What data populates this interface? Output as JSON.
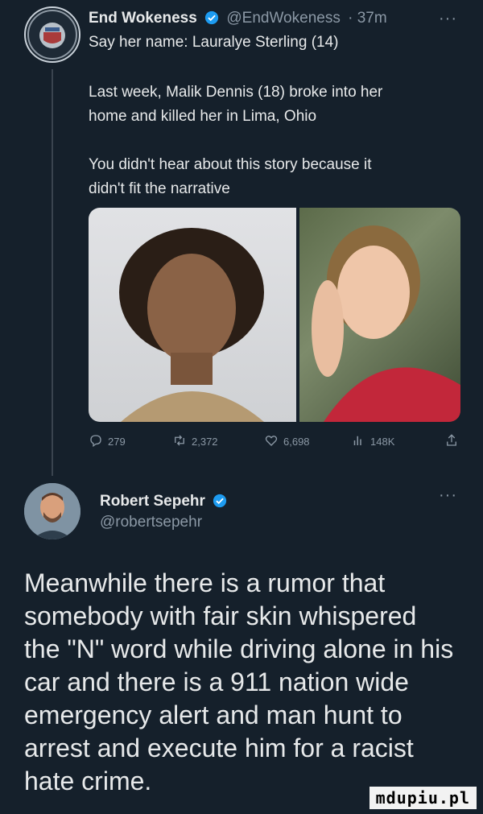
{
  "tweet1": {
    "display_name": "End Wokeness",
    "handle": "@EndWokeness",
    "time": "· 37m",
    "more": "···",
    "lines": [
      "Say her name: Lauralye Sterling (14)",
      "Last week, Malik Dennis (18) broke into her",
      "home and killed her in Lima, Ohio",
      "You didn't hear about this story because it",
      "didn't fit the narrative"
    ],
    "stats": {
      "replies": "279",
      "retweets": "2,372",
      "likes": "6,698",
      "views": "148K"
    }
  },
  "tweet2": {
    "display_name": "Robert Sepehr",
    "handle": "@robertsepehr",
    "more": "···",
    "lines": [
      "Meanwhile there is a rumor that",
      "somebody with fair skin whispered",
      "the \"N\" word while driving alone in his",
      "car and there is a 911 nation wide",
      "emergency alert and man hunt to",
      "arrest and execute him for a racist",
      "hate crime."
    ]
  },
  "watermark": "mdupiu.pl",
  "colors": {
    "background": "#15202b",
    "text": "#e7e9ea",
    "muted": "#8b98a5",
    "verified": "#1d9bf0"
  }
}
